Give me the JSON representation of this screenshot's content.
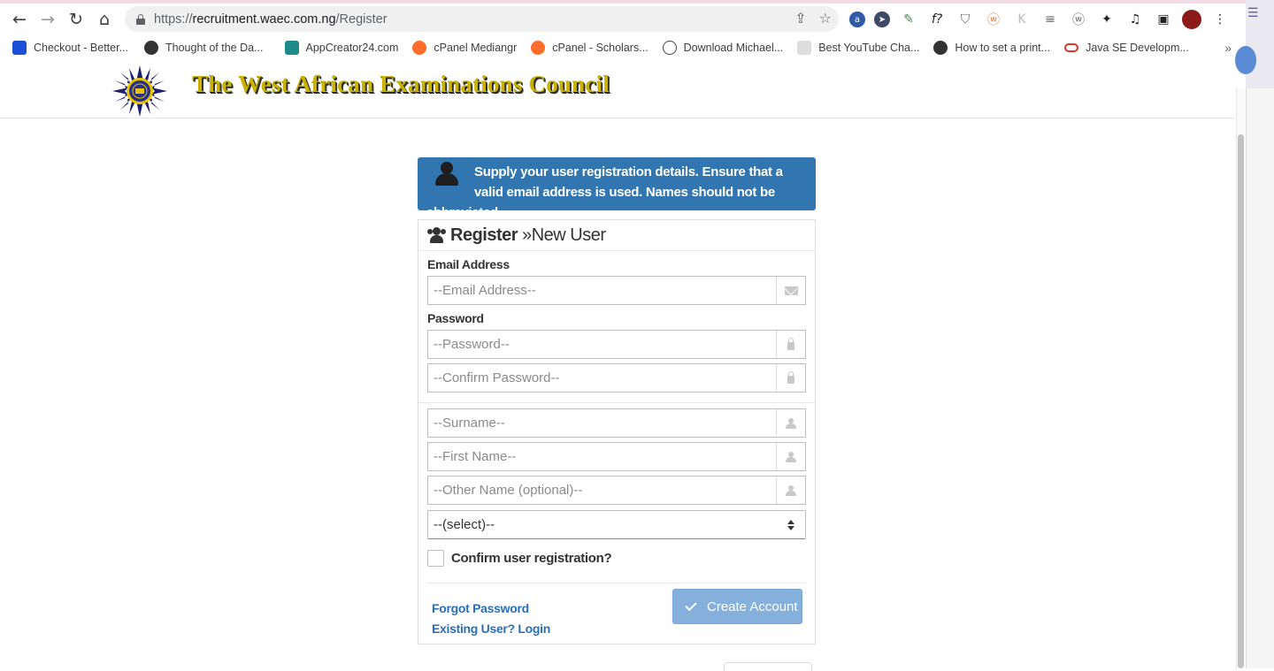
{
  "browser": {
    "url_scheme": "https://",
    "url_host": "recruitment.waec.com.ng",
    "url_path": "/Register",
    "bookmarks": [
      {
        "label": "Checkout - Better...",
        "color": "#1a4fd6"
      },
      {
        "label": "Thought of the Da...",
        "color": "#333333"
      },
      {
        "label": "AppCreator24.com",
        "color": "#1f8a8a"
      },
      {
        "label": "cPanel Mediangr",
        "color": "#ff6c2c"
      },
      {
        "label": "cPanel - Scholars...",
        "color": "#ff6c2c"
      },
      {
        "label": "Download Michael...",
        "color": "#444444"
      },
      {
        "label": "Best YouTube Cha...",
        "color": "#666666"
      },
      {
        "label": "How to set a print...",
        "color": "#333333"
      },
      {
        "label": "Java SE Developm...",
        "color": "#d9372b"
      }
    ],
    "bookmarks_more": "»"
  },
  "site": {
    "title": "The West African Examinations Council",
    "title_color": "#c9b300"
  },
  "notice": {
    "text": "Supply your user registration details. Ensure that a valid email address is used. Names should not be abbreviated",
    "bg_color": "#3276b1"
  },
  "form": {
    "heading_bold": "Register",
    "heading_rest": "»New User",
    "email_label": "Email Address",
    "email_placeholder": "--Email Address--",
    "password_label": "Password",
    "password_placeholder": "--Password--",
    "confirm_password_placeholder": "--Confirm Password--",
    "surname_placeholder": "--Surname--",
    "first_name_placeholder": "--First Name--",
    "other_name_placeholder": "--Other Name (optional)--",
    "select_value": "--(select)--",
    "confirm_label": "Confirm user registration?",
    "forgot_password": "Forgot Password",
    "existing_user": "Existing User? Login",
    "create_account": "Create Account",
    "link_color": "#2a6ebb",
    "button_color": "#86b0dc"
  }
}
